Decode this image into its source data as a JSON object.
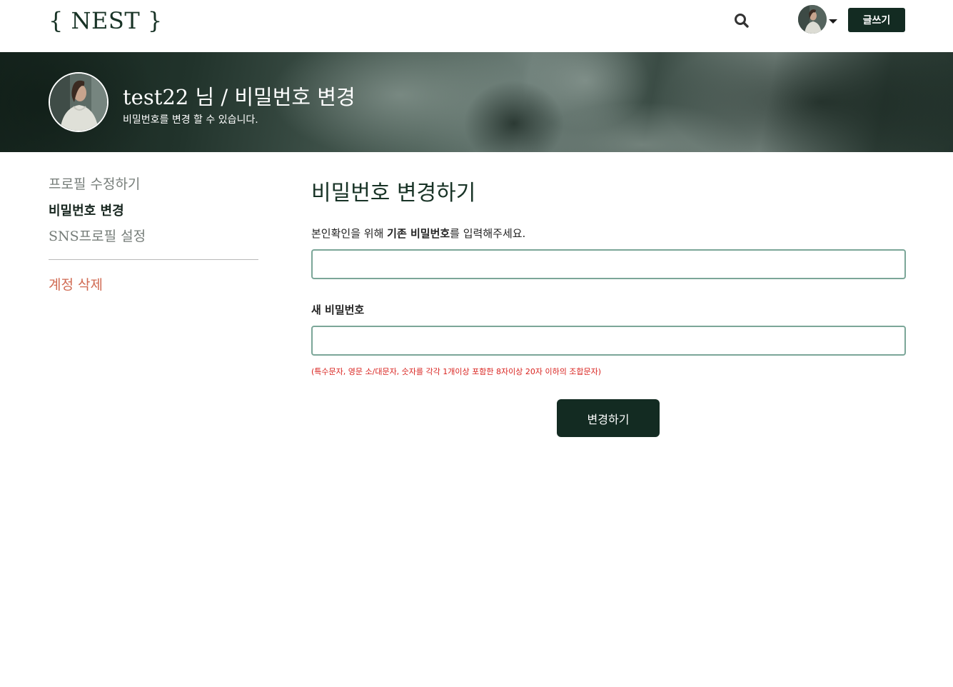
{
  "header": {
    "logo": "{ NEST }",
    "write_label": "글쓰기"
  },
  "banner": {
    "title": "test22 님 / 비밀번호 변경",
    "subtitle": "비밀번호를 변경 할 수 있습니다."
  },
  "sidebar": {
    "items": [
      {
        "label": "프로필 수정하기"
      },
      {
        "label": "비밀번호 변경"
      },
      {
        "label": "SNS프로필 설정"
      }
    ],
    "delete_label": "계정 삭제"
  },
  "main": {
    "title": "비밀번호 변경하기",
    "current_label_prefix": "본인확인을 위해 ",
    "current_label_bold": "기존 비밀번호",
    "current_label_suffix": "를 입력해주세요.",
    "current_value": "",
    "new_label": "새 비밀번호",
    "new_value": "",
    "hint": "(특수문자, 영문 소/대문자, 숫자를 각각 1개이상 포함한 8자이상 20자 이하의 조합문자)",
    "submit_label": "변경하기"
  },
  "colors": {
    "brand_dark": "#132b22",
    "input_border": "#7ba698",
    "danger": "#d06a52",
    "hint": "#d9231f"
  },
  "icons": {
    "search": "search-icon",
    "caret": "chevron-down-icon"
  }
}
